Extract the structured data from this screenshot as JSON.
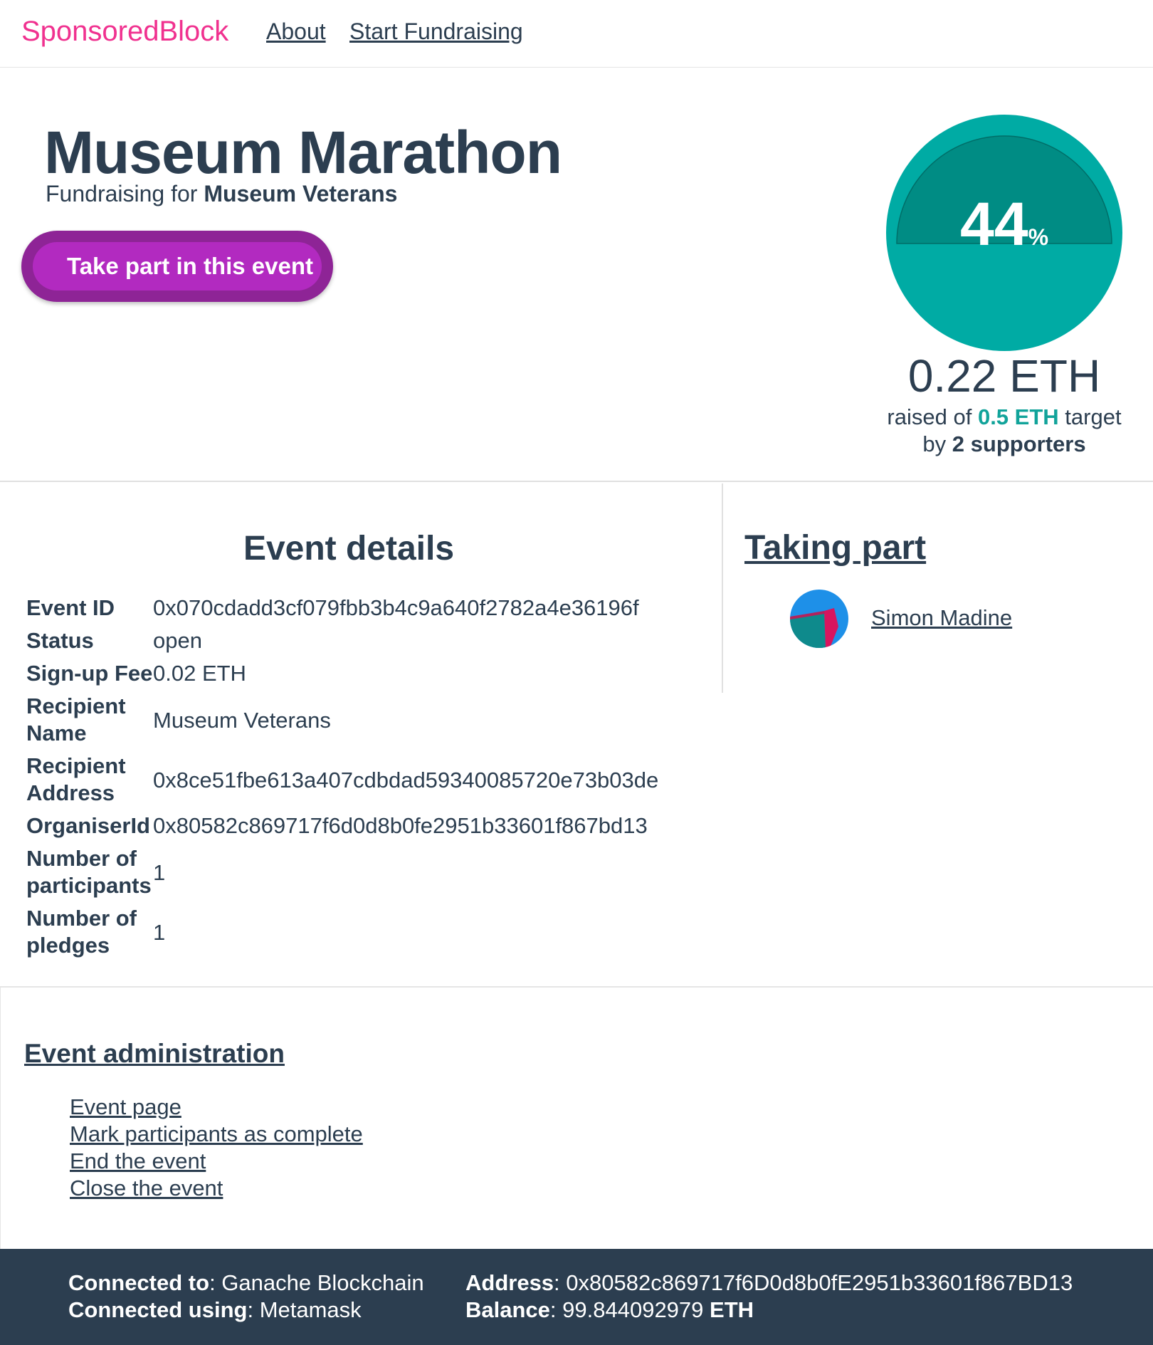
{
  "nav": {
    "brand": "SponsoredBlock",
    "links": [
      "About",
      "Start Fundraising"
    ]
  },
  "event": {
    "title": "Museum Marathon",
    "subtitle_prefix": "Fundraising for",
    "recipient": "Museum Veterans",
    "take_part_label": "Take part in this event"
  },
  "progress": {
    "percent": "44",
    "percent_sign": "%",
    "fraction": 0.44,
    "raised": "0.22 ETH",
    "raised_prefix": "raised of",
    "target": "0.5 ETH",
    "target_suffix": "target",
    "by_label": "by",
    "supporters": "2 supporters",
    "colors": {
      "fill": "#00aba4",
      "dark": "#008c84"
    }
  },
  "details": {
    "heading": "Event details",
    "rows": [
      {
        "label": "Event ID",
        "value": "0x070cdadd3cf079fbb3b4c9a640f2782a4e36196f"
      },
      {
        "label": "Status",
        "value": "open"
      },
      {
        "label": "Sign-up Fee",
        "value": "0.02 ETH"
      },
      {
        "label": "Recipient Name",
        "value": "Museum Veterans"
      },
      {
        "label": "Recipient Address",
        "value": "0x8ce51fbe613a407cdbdad59340085720e73b03de"
      },
      {
        "label": "OrganiserId",
        "value": "0x80582c869717f6d0d8b0fe2951b33601f867bd13"
      },
      {
        "label": "Number of participants",
        "value": "1"
      },
      {
        "label": "Number of pledges",
        "value": "1"
      }
    ]
  },
  "taking_part": {
    "heading": "Taking part",
    "participants": [
      {
        "name": "Simon Madine"
      }
    ]
  },
  "admin": {
    "heading": "Event administration",
    "links": [
      "Event page",
      "Mark participants as complete",
      "End the event",
      "Close the event"
    ]
  },
  "footer": {
    "connected_to_label": "Connected to",
    "connected_to": "Ganache Blockchain",
    "connected_using_label": "Connected using",
    "connected_using": "Metamask",
    "address_label": "Address",
    "address": "0x80582c869717f6D0d8b0fE2951b33601f867BD13",
    "balance_label": "Balance",
    "balance": "99.844092979",
    "balance_unit": "ETH"
  }
}
